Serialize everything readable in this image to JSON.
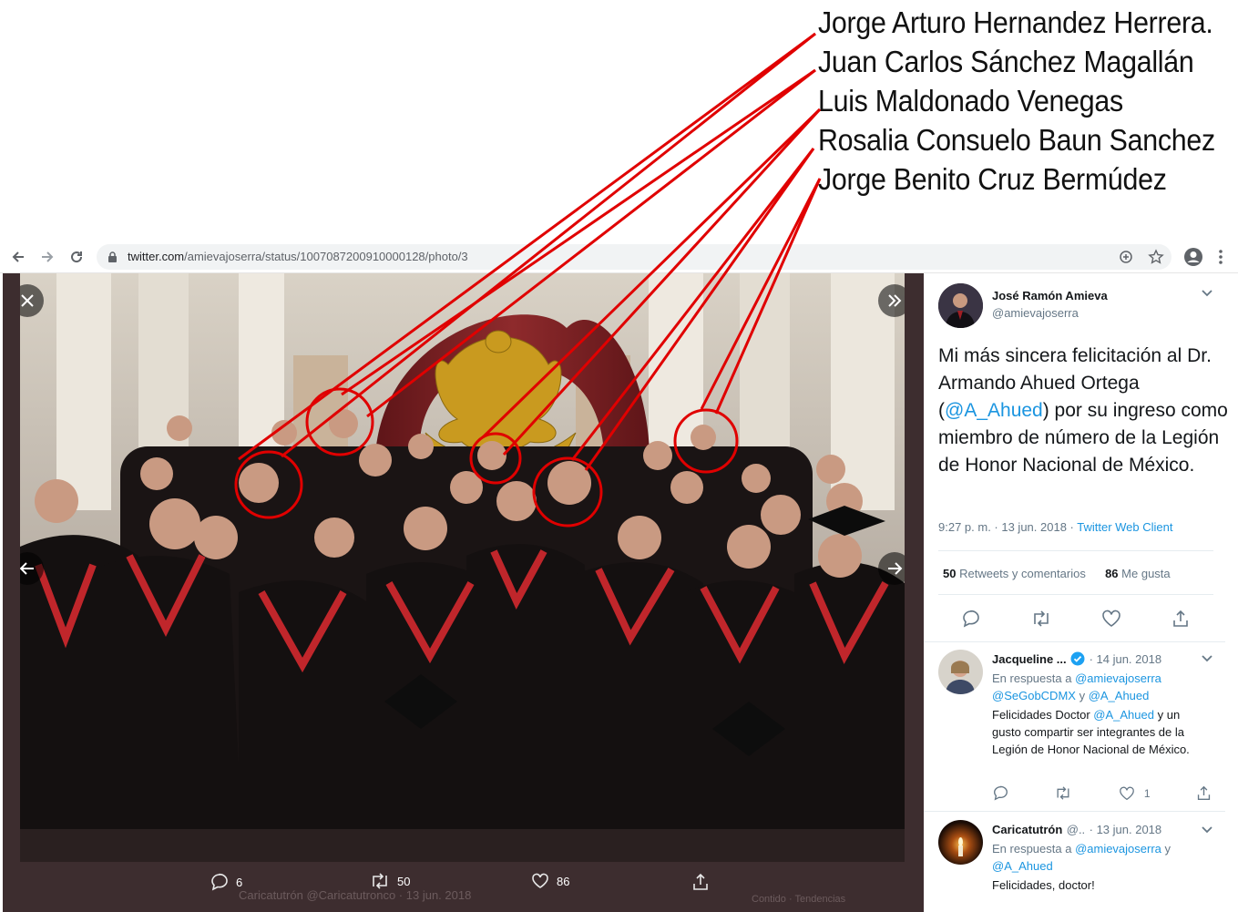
{
  "annotations": {
    "names": [
      "Jorge Arturo Hernandez Herrera.",
      "Juan Carlos Sánchez Magallán",
      "Luis Maldonado Venegas",
      "Rosalia Consuelo Baun Sanchez",
      "Jorge Benito Cruz Bermúdez"
    ],
    "line_color": "#e00000"
  },
  "browser": {
    "url_host": "twitter.com",
    "url_path": "/amievajoserra/status/1007087200910000128/photo/3",
    "back_icon": "arrow-left-icon",
    "forward_icon": "arrow-right-icon",
    "reload_icon": "reload-icon",
    "lock_icon": "lock-icon",
    "zoom_icon": "zoom-plus-icon",
    "bookmark_icon": "star-icon",
    "profile_icon": "account-circle-icon",
    "menu_icon": "kebab-menu-icon"
  },
  "photo_viewer": {
    "actions": {
      "replies": "6",
      "retweets": "50",
      "likes": "86"
    },
    "faded_footer": {
      "name": "Caricatutrón",
      "handle": "@Caricatutronco",
      "date": "13 jun. 2018",
      "right_faded": "Contido · Tendencias"
    }
  },
  "tweet": {
    "author_name": "José Ramón Amieva",
    "author_handle": "@amievajoserra",
    "text_before": "Mi más sincera felicitación al Dr. Armando Ahued Ortega (",
    "mention": "@A_Ahued",
    "text_after": ") por su ingreso como miembro de número de la Legión de Honor Nacional de México.",
    "time": "9:27 p. m. · 13 jun. 2018 · ",
    "client": "Twitter Web Client",
    "retweets_count": "50",
    "retweets_label": "Retweets y comentarios",
    "likes_count": "86",
    "likes_label": "Me gusta"
  },
  "replies": [
    {
      "name": "Jacqueline ...",
      "date": "· 14 jun. 2018",
      "in_reply_prefix": "En respuesta a ",
      "in_reply_1": "@amievajoserra",
      "in_reply_2": "@SeGobCDMX",
      "in_reply_join": " y ",
      "in_reply_3": "@A_Ahued",
      "text_1": "Felicidades Doctor ",
      "text_mention": "@A_Ahued",
      "text_2": " y un gusto compartir ser integrantes de la Legión de Honor Nacional de México.",
      "likes": "1"
    },
    {
      "name": "Caricatutrón",
      "handle_short": "@..",
      "date": "· 13 jun. 2018",
      "in_reply_prefix": "En respuesta a ",
      "in_reply_1": "@amievajoserra",
      "in_reply_join": " y",
      "in_reply_2": "@A_Ahued",
      "text": "Felicidades, doctor!"
    }
  ]
}
